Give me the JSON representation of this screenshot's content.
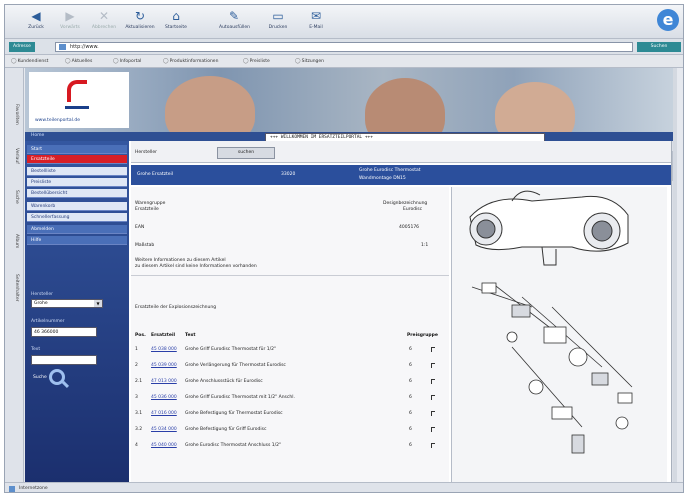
{
  "toolbar": {
    "buttons": [
      {
        "label": "Zurück",
        "icon": "back-arrow-icon",
        "enabled": true
      },
      {
        "label": "Vorwärts",
        "icon": "forward-arrow-icon",
        "enabled": false
      },
      {
        "label": "Abbrechen",
        "icon": "stop-icon",
        "enabled": false
      },
      {
        "label": "Aktualisieren",
        "icon": "refresh-icon",
        "enabled": true
      },
      {
        "label": "Startseite",
        "icon": "home-icon",
        "enabled": true
      },
      {
        "label": "Autoausfüllen",
        "icon": "autofill-icon",
        "enabled": true
      },
      {
        "label": "Drucken",
        "icon": "print-icon",
        "enabled": true
      },
      {
        "label": "E-Mail",
        "icon": "mail-icon",
        "enabled": true
      }
    ]
  },
  "address": {
    "label": "Adresse",
    "url": "http://www.",
    "go_label": "Suchen"
  },
  "links": [
    "Kundendienst",
    "Aktuelles",
    "Infoportal",
    "Produktinformationen",
    "Preisliste",
    "Sitzungen"
  ],
  "explorer_tabs": [
    "Favoriten",
    "Verlauf",
    "Suche",
    "Album",
    "Seitenhalter"
  ],
  "status": {
    "text": "Internetzone"
  },
  "page": {
    "logo_text": "www.teilenportal.de",
    "nav_header": "Home",
    "ticker": "+++ WILLKOMMEN IM ERSATZTEILPORTAL +++"
  },
  "sidebar": {
    "items": [
      {
        "label": "Start",
        "style": "blue"
      },
      {
        "label": "Ersatzteile",
        "style": "sel"
      },
      {
        "label": "Bestellliste",
        "style": "light"
      },
      {
        "label": "Preisliste",
        "style": "light"
      },
      {
        "label": "Bestellübersicht",
        "style": "light"
      },
      {
        "label": "Warenkorb",
        "style": "light"
      },
      {
        "label": "Schnellerfassung",
        "style": "light"
      },
      {
        "label": "Abmelden",
        "style": "blue"
      },
      {
        "label": "Hilfe",
        "style": "blue"
      }
    ],
    "brand_label": "Hersteller",
    "brand_value": "Grohe",
    "artno_label": "Artikelnummer",
    "artno_value": "46 366000",
    "text_label": "Text",
    "text_value": "",
    "search_label": "Suche"
  },
  "content": {
    "filter_label": "Hersteller",
    "filter_button": "suchen",
    "hit": {
      "name": "Grohe Ersatzteil",
      "number": "33020",
      "desc1": "Grohe Eurodisc Thermostat",
      "desc2": "Wandmontage DN15"
    },
    "details": [
      {
        "key": "Warengruppe",
        "sub": "Ersatzteile",
        "right": "Designbezeichnung",
        "right_sub": "Eurodisc"
      },
      {
        "key": "EAN",
        "sub": "",
        "right": "4005176",
        "right_sub": ""
      },
      {
        "key": "Maßstab",
        "sub": "",
        "right": "1:1",
        "right_sub": ""
      }
    ],
    "note1": "Weitere Informationen zu diesem Artikel",
    "note2": "zu diesem Artikel sind keine Informationen vorhanden",
    "table_title": "Ersatzteile der Explosionszeichnung",
    "table_headers": {
      "pos": "Pos.",
      "artno": "Ersatzteil",
      "text": "Text",
      "group": "Preisgruppe"
    },
    "rows": [
      {
        "pos": "1",
        "artno": "45 038 000",
        "text": "Grohe Griff Eurodisc Thermostat für 1/2\"",
        "group": "6"
      },
      {
        "pos": "2",
        "artno": "45 039 000",
        "text": "Grohe Verlängerung für Thermostat Eurodisc",
        "group": "6"
      },
      {
        "pos": "2.1",
        "artno": "47 013 000",
        "text": "Grohe Anschlussstück für Eurodisc",
        "group": "6"
      },
      {
        "pos": "3",
        "artno": "45 036 000",
        "text": "Grohe Griff Eurodisc Thermostat mit 1/2\" Anschl.",
        "group": "6"
      },
      {
        "pos": "3.1",
        "artno": "47 016 000",
        "text": "Grohe Befestigung für Thermostat Eurodisc",
        "group": "6"
      },
      {
        "pos": "3.2",
        "artno": "45 034 000",
        "text": "Grohe Befestigung für Griff Eurodisc",
        "group": "6"
      },
      {
        "pos": "4",
        "artno": "45 040 000",
        "text": "Grohe Eurodisc Thermostat Anschluss 1/2\"",
        "group": "6"
      }
    ]
  }
}
